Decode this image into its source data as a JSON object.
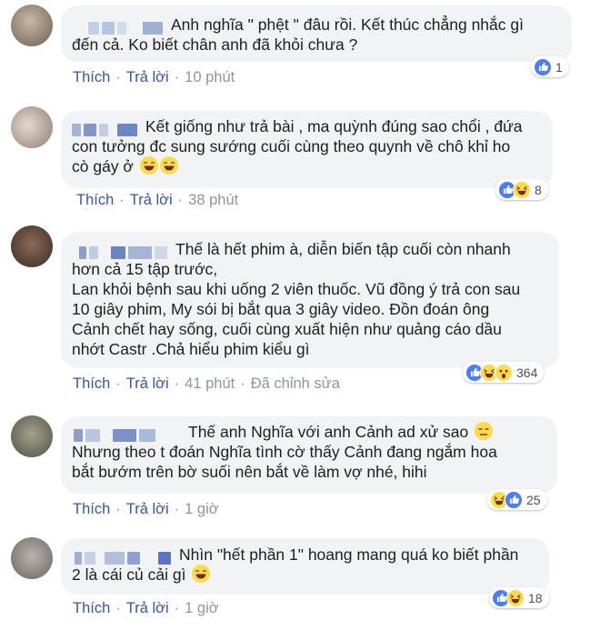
{
  "actions": {
    "like": "Thích",
    "reply": "Trả lời",
    "edited": "Đã chỉnh sửa"
  },
  "comments": [
    {
      "lines": [
        "Anh nghĩa \" phệt \" đâu rồi. Kết thúc chẳng nhắc gì",
        "đến cả. Ko biết chân anh đã khỏi chưa ?"
      ],
      "time": "10 phút",
      "reactions": [
        "like"
      ],
      "count": "1"
    },
    {
      "lines": [
        "Kết giống như trả bài , ma quỳnh đúng sao chổi , đứa",
        "con tưởng đc sung sướng cuối cùng theo quynh về chô khỉ ho",
        "cò gáy ở"
      ],
      "emoji_after_last": [
        "haha",
        "haha"
      ],
      "time": "38 phút",
      "reactions": [
        "like",
        "haha"
      ],
      "count": "8"
    },
    {
      "lines": [
        "Thế là hết phim à, diễn biến tập cuối còn nhanh",
        "hơn cả 15 tập trước,",
        "Lan khỏi bệnh sau khi uống 2 viên thuốc. Vũ đồng ý trả con sau",
        "10 giây phim, My sói bị bắt qua 3 giây video. Đồn đoán ông",
        "Cảnh chết hay sống, cuối cùng xuất hiện như quảng cáo dầu",
        "nhớt Castr .Chả hiểu phim kiểu gì"
      ],
      "time": "41 phút",
      "reactions": [
        "like",
        "haha",
        "wow"
      ],
      "count": "364"
    },
    {
      "lines": [
        "Thế anh Nghĩa với anh Cảnh ad xử sao",
        "Nhưng theo t đoán Nghĩa tình cờ thấy Cảnh đang ngắm hoa",
        "bắt bướm trên bờ suối nên bắt về làm vợ nhé, hihi"
      ],
      "emoji_after_first": [
        "expressionless"
      ],
      "time": "1 giờ",
      "reactions": [
        "haha",
        "like"
      ],
      "count": "25"
    },
    {
      "lines": [
        "Nhìn \"hết phần 1\" hoang mang quá ko biết phần",
        "2 là cái củ cải gì"
      ],
      "emoji_after_last": [
        "haha"
      ],
      "time": "1 giờ",
      "reactions": [
        "like",
        "haha"
      ],
      "count": "18"
    }
  ]
}
